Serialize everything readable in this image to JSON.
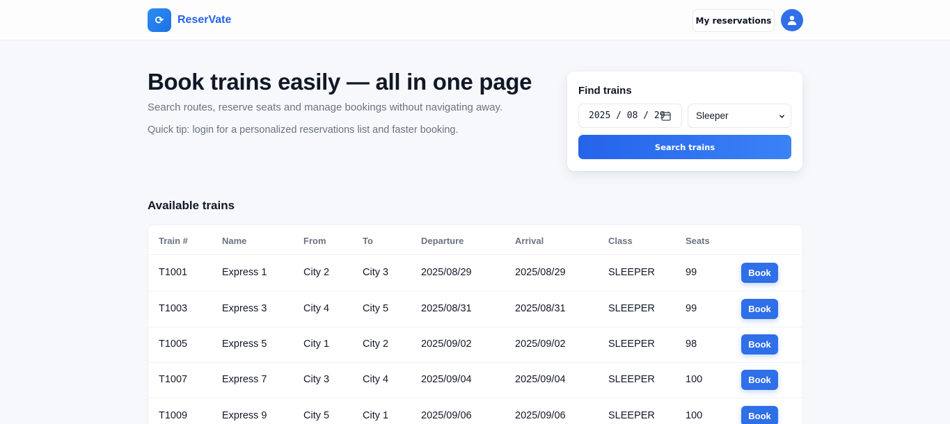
{
  "header": {
    "brand_name": "ReserVate",
    "logo_glyph": "⟳",
    "logo_icon": "refresh-icon",
    "my_reservations_label": "My reservations",
    "avatar_icon": "user-icon"
  },
  "hero": {
    "title": "Book trains easily — all in one page",
    "subtitle": "Search routes, reserve seats and manage bookings without navigating away.",
    "tip": "Quick tip: login for a personalized reservations list and faster booking."
  },
  "search": {
    "title": "Find trains",
    "date_value": "2025 / 08 / 29",
    "class_value": "Sleeper",
    "button_label": "Search trains"
  },
  "trains": {
    "title": "Available trains",
    "columns": [
      "Train #",
      "Name",
      "From",
      "To",
      "Departure",
      "Arrival",
      "Class",
      "Seats"
    ],
    "book_label": "Book",
    "rows": [
      {
        "id": "T1001",
        "name": "Express 1",
        "from": "City 2",
        "to": "City 3",
        "departure": "2025/08/29",
        "arrival": "2025/08/29",
        "class": "SLEEPER",
        "seats": "99"
      },
      {
        "id": "T1003",
        "name": "Express 3",
        "from": "City 4",
        "to": "City 5",
        "departure": "2025/08/31",
        "arrival": "2025/08/31",
        "class": "SLEEPER",
        "seats": "99"
      },
      {
        "id": "T1005",
        "name": "Express 5",
        "from": "City 1",
        "to": "City 2",
        "departure": "2025/09/02",
        "arrival": "2025/09/02",
        "class": "SLEEPER",
        "seats": "98"
      },
      {
        "id": "T1007",
        "name": "Express 7",
        "from": "City 3",
        "to": "City 4",
        "departure": "2025/09/04",
        "arrival": "2025/09/04",
        "class": "SLEEPER",
        "seats": "100"
      },
      {
        "id": "T1009",
        "name": "Express 9",
        "from": "City 5",
        "to": "City 1",
        "departure": "2025/09/06",
        "arrival": "2025/09/06",
        "class": "SLEEPER",
        "seats": "100"
      }
    ]
  },
  "colors": {
    "accent": "#2563eb",
    "background": "#f6f8fb",
    "muted_text": "#6b7280"
  }
}
